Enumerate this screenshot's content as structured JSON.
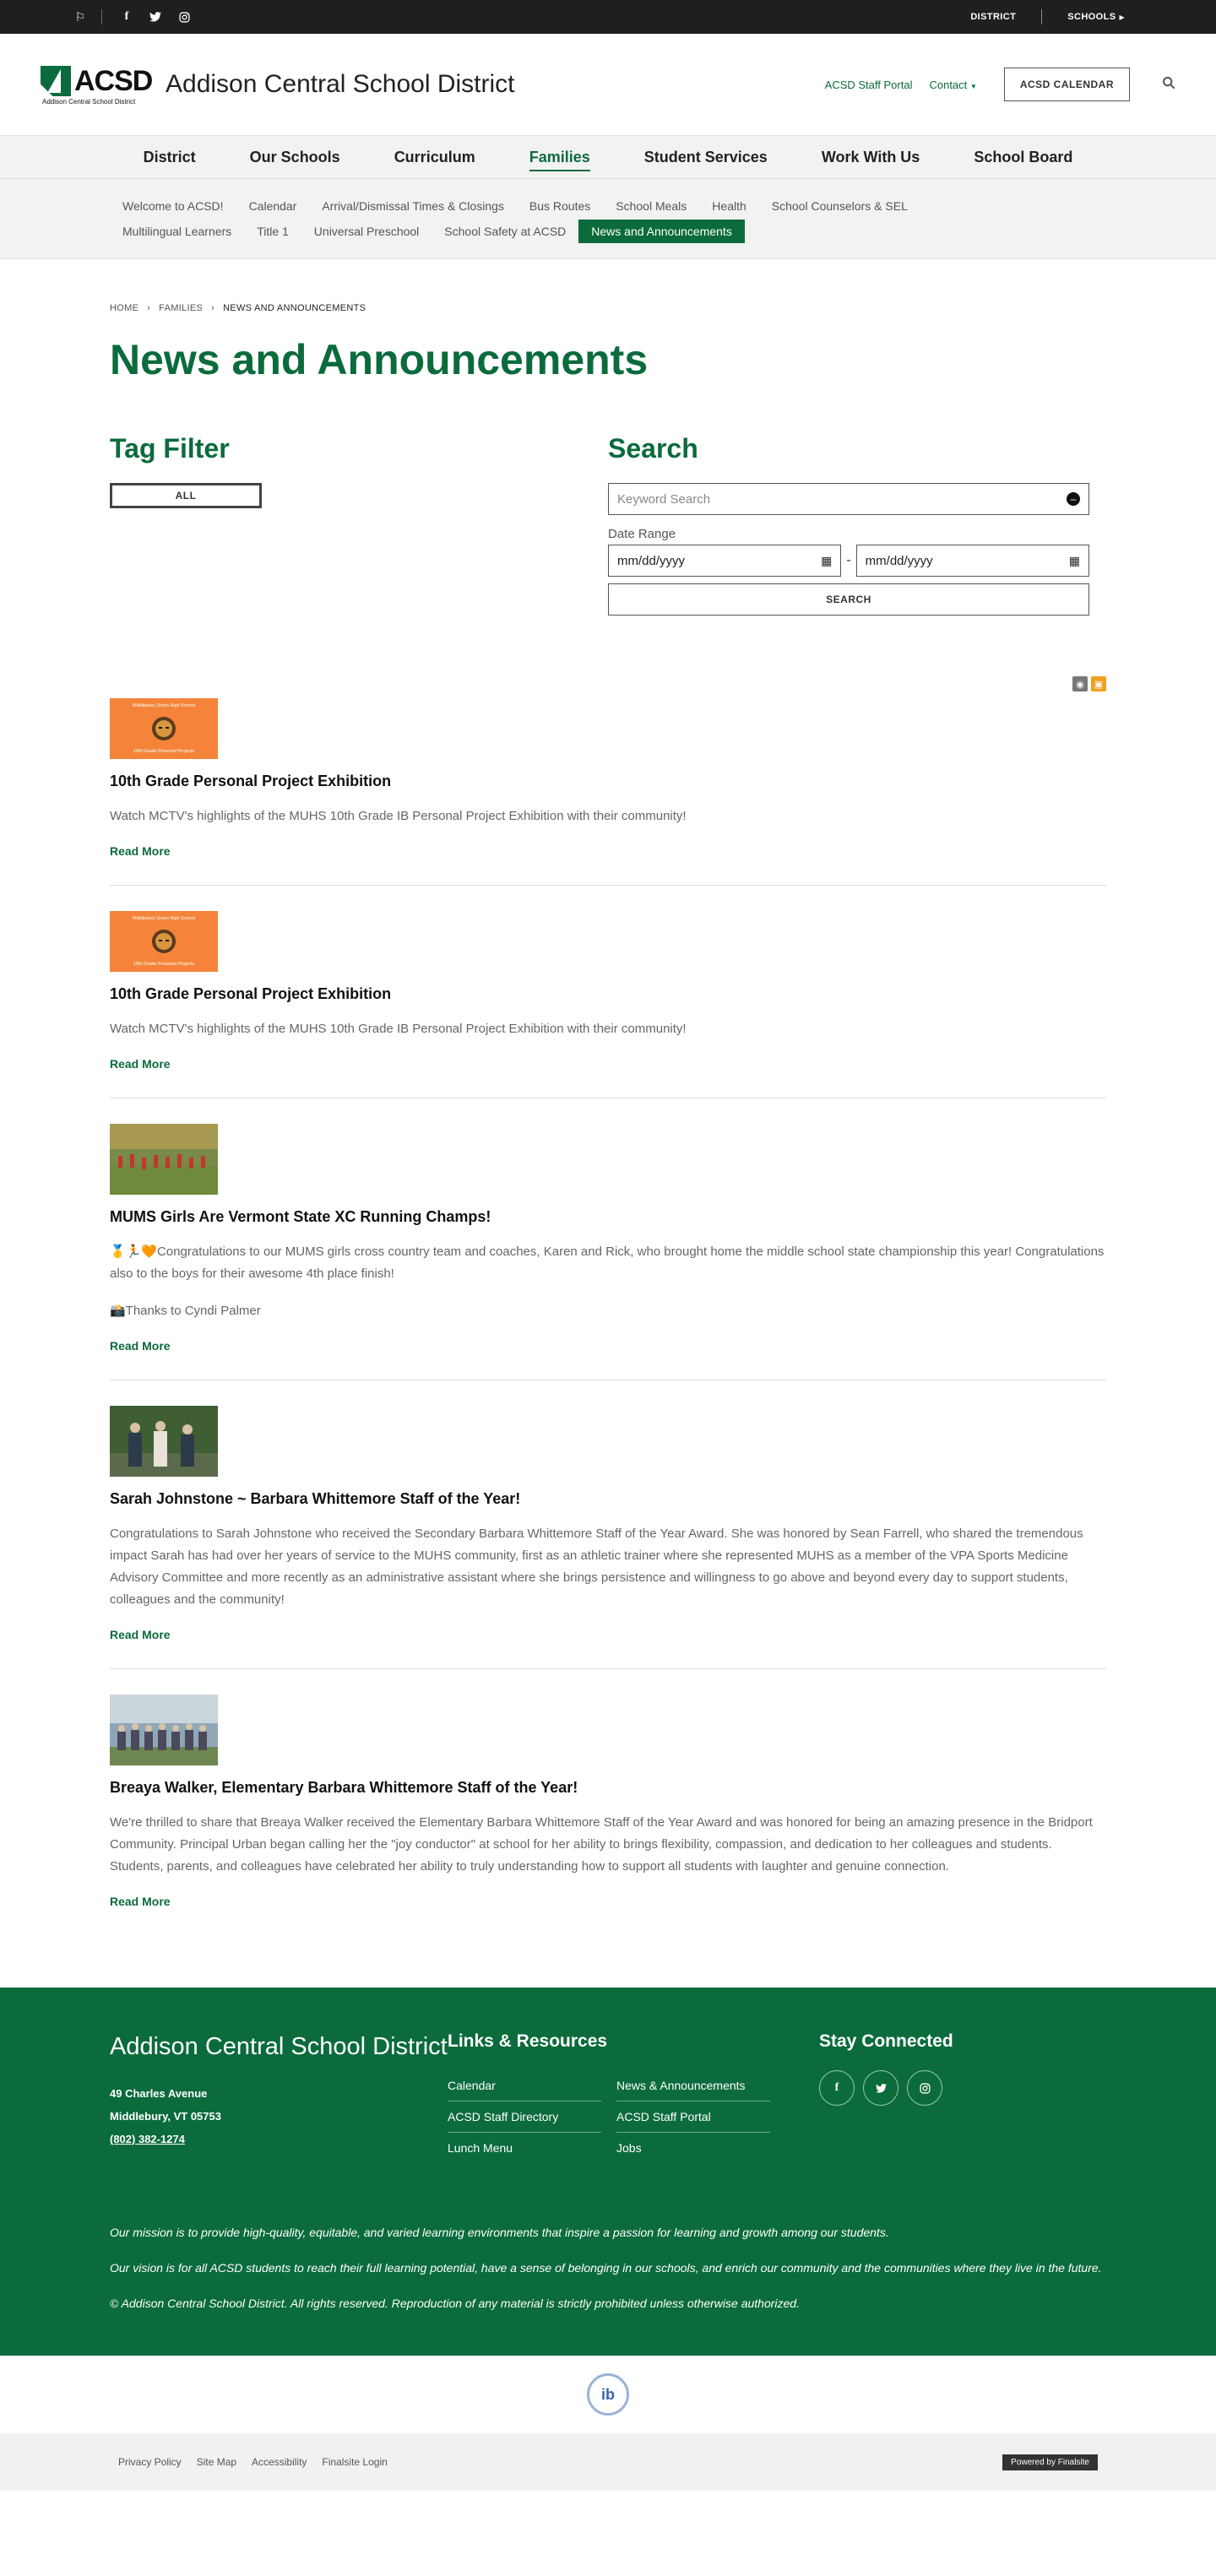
{
  "utility": {
    "district": "DISTRICT",
    "schools": "SCHOOLS"
  },
  "header": {
    "logo_text": "ACSD",
    "logo_sub": "Addison Central School District",
    "site_name": "Addison Central School District",
    "staff_portal": "ACSD Staff Portal",
    "contact": "Contact",
    "calendar_btn": "ACSD CALENDAR"
  },
  "mainnav": [
    "District",
    "Our Schools",
    "Curriculum",
    "Families",
    "Student Services",
    "Work With Us",
    "School Board"
  ],
  "subnav": {
    "row1": [
      "Welcome to ACSD!",
      "Calendar",
      "Arrival/Dismissal Times & Closings",
      "Bus Routes",
      "School Meals",
      "Health",
      "School Counselors & SEL"
    ],
    "row2": [
      "Multilingual Learners",
      "Title 1",
      "Universal Preschool",
      "School Safety at ACSD",
      "News and Announcements"
    ]
  },
  "breadcrumb": [
    "HOME",
    "FAMILIES",
    "NEWS AND ANNOUNCEMENTS"
  ],
  "page_title": "News and Announcements",
  "tag_filter": {
    "title": "Tag Filter",
    "all": "ALL"
  },
  "search": {
    "title": "Search",
    "keyword_placeholder": "Keyword Search",
    "date_range_label": "Date Range",
    "date_from": "mm/dd/yyyy",
    "date_sep": "-",
    "date_to": "mm/dd/yyyy",
    "button": "SEARCH"
  },
  "posts": [
    {
      "title": "10th Grade Personal Project Exhibition",
      "body": "Watch MCTV's highlights of the MUHS 10th Grade IB Personal Project Exhibition with their community!",
      "body2": "",
      "read_more": "Read More",
      "thumb_top": "Middlebury Union High School",
      "thumb_bottom": "10th Grade Personal Projects"
    },
    {
      "title": "10th Grade Personal Project Exhibition",
      "body": "Watch MCTV's highlights of the MUHS 10th Grade IB Personal Project Exhibition with their community!",
      "body2": "",
      "read_more": "Read More",
      "thumb_top": "Middlebury Union High School",
      "thumb_bottom": "10th Grade Personal Projects"
    },
    {
      "title": "MUMS Girls Are Vermont State XC Running Champs!",
      "body": "🥇🏃🧡Congratulations to our MUMS girls cross country team and coaches, Karen and Rick, who brought home the middle school state championship this year! Congratulations also to the boys for their awesome 4th place finish!",
      "body2": "📸Thanks to Cyndi Palmer",
      "read_more": "Read More"
    },
    {
      "title": "Sarah Johnstone ~ Barbara Whittemore Staff of the Year!",
      "body": "Congratulations to Sarah Johnstone who received the Secondary Barbara Whittemore Staff of the Year Award. She was honored by Sean Farrell, who shared the tremendous impact Sarah has had over her years of service to the MUHS community, first as an athletic trainer where she represented MUHS as a member of the VPA Sports Medicine Advisory Committee and more recently as an administrative assistant where she brings persistence and willingness to go above and beyond every day to support students, colleagues and the community!",
      "body2": "",
      "read_more": "Read More"
    },
    {
      "title": "Breaya Walker, Elementary Barbara Whittemore Staff of the Year!",
      "body": "We're thrilled to share that Breaya Walker received the Elementary Barbara Whittemore Staff of the Year Award and was honored for being an amazing presence in the Bridport Community. Principal Urban began calling her the \"joy conductor\" at school for her ability to brings flexibility, compassion, and dedication to her colleagues and students. Students, parents, and colleagues have celebrated her ability to truly understanding how to support all students with laughter and genuine connection.",
      "body2": "",
      "read_more": "Read More"
    }
  ],
  "footer": {
    "org": "Addison Central School District",
    "address1": "49 Charles Avenue",
    "address2": "Middlebury, VT  05753",
    "phone": "(802) 382-1274",
    "links_title": "Links & Resources",
    "links": [
      "Calendar",
      "News & Announcements",
      "ACSD Staff Directory",
      "ACSD Staff Portal",
      "Lunch Menu",
      "Jobs"
    ],
    "social_title": "Stay Connected",
    "mission": "Our mission is to provide high-quality, equitable, and varied learning environments that inspire a passion for learning and growth among our students.",
    "vision": "Our vision is for all ACSD students to reach their full learning potential, have a sense of belonging in our schools, and enrich our community and the communities where they live in the future.",
    "copyright": "© Addison Central School District.  All rights reserved.  Reproduction of any material is strictly prohibited unless otherwise authorized."
  },
  "bottom": {
    "links": [
      "Privacy Policy",
      "Site Map",
      "Accessibility",
      "Finalsite Login"
    ],
    "powered": "Powered by Finalsite"
  },
  "colors": {
    "brand_green": "#0b6b3c",
    "utility_bg": "#1f1f1f",
    "nav_bg": "#f2f2f2"
  },
  "icons": [
    "translate-icon",
    "facebook-icon",
    "twitter-icon",
    "instagram-icon",
    "search-icon",
    "rss-icon",
    "ical-icon",
    "calendar-icon",
    "clear-icon"
  ]
}
